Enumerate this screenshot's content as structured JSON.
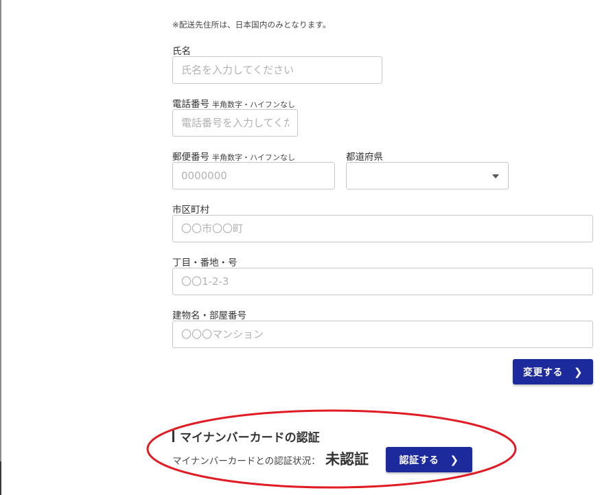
{
  "form": {
    "note": "※配送先住所は、日本国内のみとなります。",
    "name": {
      "label": "氏名",
      "placeholder": "氏名を入力してください",
      "value": ""
    },
    "phone": {
      "label": "電話番号",
      "sublabel": "半角数字・ハイフンなし",
      "placeholder": "電話番号を入力してください",
      "value": ""
    },
    "postal": {
      "label": "郵便番号",
      "sublabel": "半角数字・ハイフンなし",
      "placeholder": "0000000",
      "value": ""
    },
    "prefecture": {
      "label": "都道府県",
      "value": ""
    },
    "city": {
      "label": "市区町村",
      "placeholder": "〇〇市〇〇町",
      "value": ""
    },
    "street": {
      "label": "丁目・番地・号",
      "placeholder": "〇〇1-2-3",
      "value": ""
    },
    "building": {
      "label": "建物名・部屋番号",
      "placeholder": "〇〇〇マンション",
      "value": ""
    },
    "submit_label": "変更する",
    "submit_icon": "chevron-right-icon"
  },
  "mynumber": {
    "title": "マイナンバーカードの認証",
    "status_label": "マイナンバーカードとの認証状況：",
    "status_value": "未認証",
    "button_label": "認証する",
    "button_icon": "chevron-right-icon"
  },
  "colors": {
    "primary_button": "#1d2a9c",
    "annotation_ellipse": "#e01b24",
    "input_border": "#c7c7c7",
    "placeholder": "#b2b2b2"
  }
}
